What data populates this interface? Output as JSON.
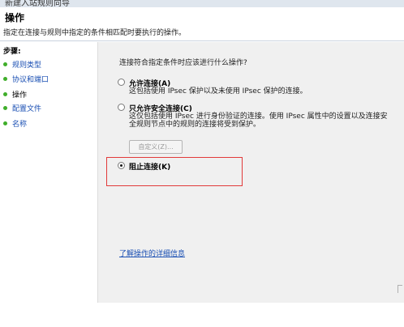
{
  "window": {
    "title_partial": "新建入站规则向导"
  },
  "header": {
    "title": "操作",
    "description": "指定在连接与规则中指定的条件相匹配时要执行的操作。"
  },
  "sidebar": {
    "steps_title": "步骤:",
    "items": [
      {
        "label": "规则类型",
        "active": false
      },
      {
        "label": "协议和端口",
        "active": false
      },
      {
        "label": "操作",
        "active": true
      },
      {
        "label": "配置文件",
        "active": false
      },
      {
        "label": "名称",
        "active": false
      }
    ]
  },
  "main": {
    "question": "连接符合指定条件时应该进行什么操作?",
    "options": [
      {
        "label": "允许连接(A)",
        "description": [
          "这包括使用 IPsec 保护以及未使用 IPsec 保护的连接。"
        ],
        "checked": false
      },
      {
        "label": "只允许安全连接(C)",
        "description": [
          "这仅包括使用 IPsec 进行身份验证的连接。使用 IPsec 属性中的设置以及连接安",
          "全规则节点中的规则的连接将受到保护。"
        ],
        "checked": false
      },
      {
        "label": "阻止连接(K)",
        "description": [],
        "checked": true
      }
    ],
    "customize_button": "自定义(Z)...",
    "learn_more_link": "了解操作的详细信息"
  },
  "colors": {
    "step_dot": "#3fae2a",
    "link": "#1a4fb3",
    "highlight_box": "#e23a3a"
  }
}
